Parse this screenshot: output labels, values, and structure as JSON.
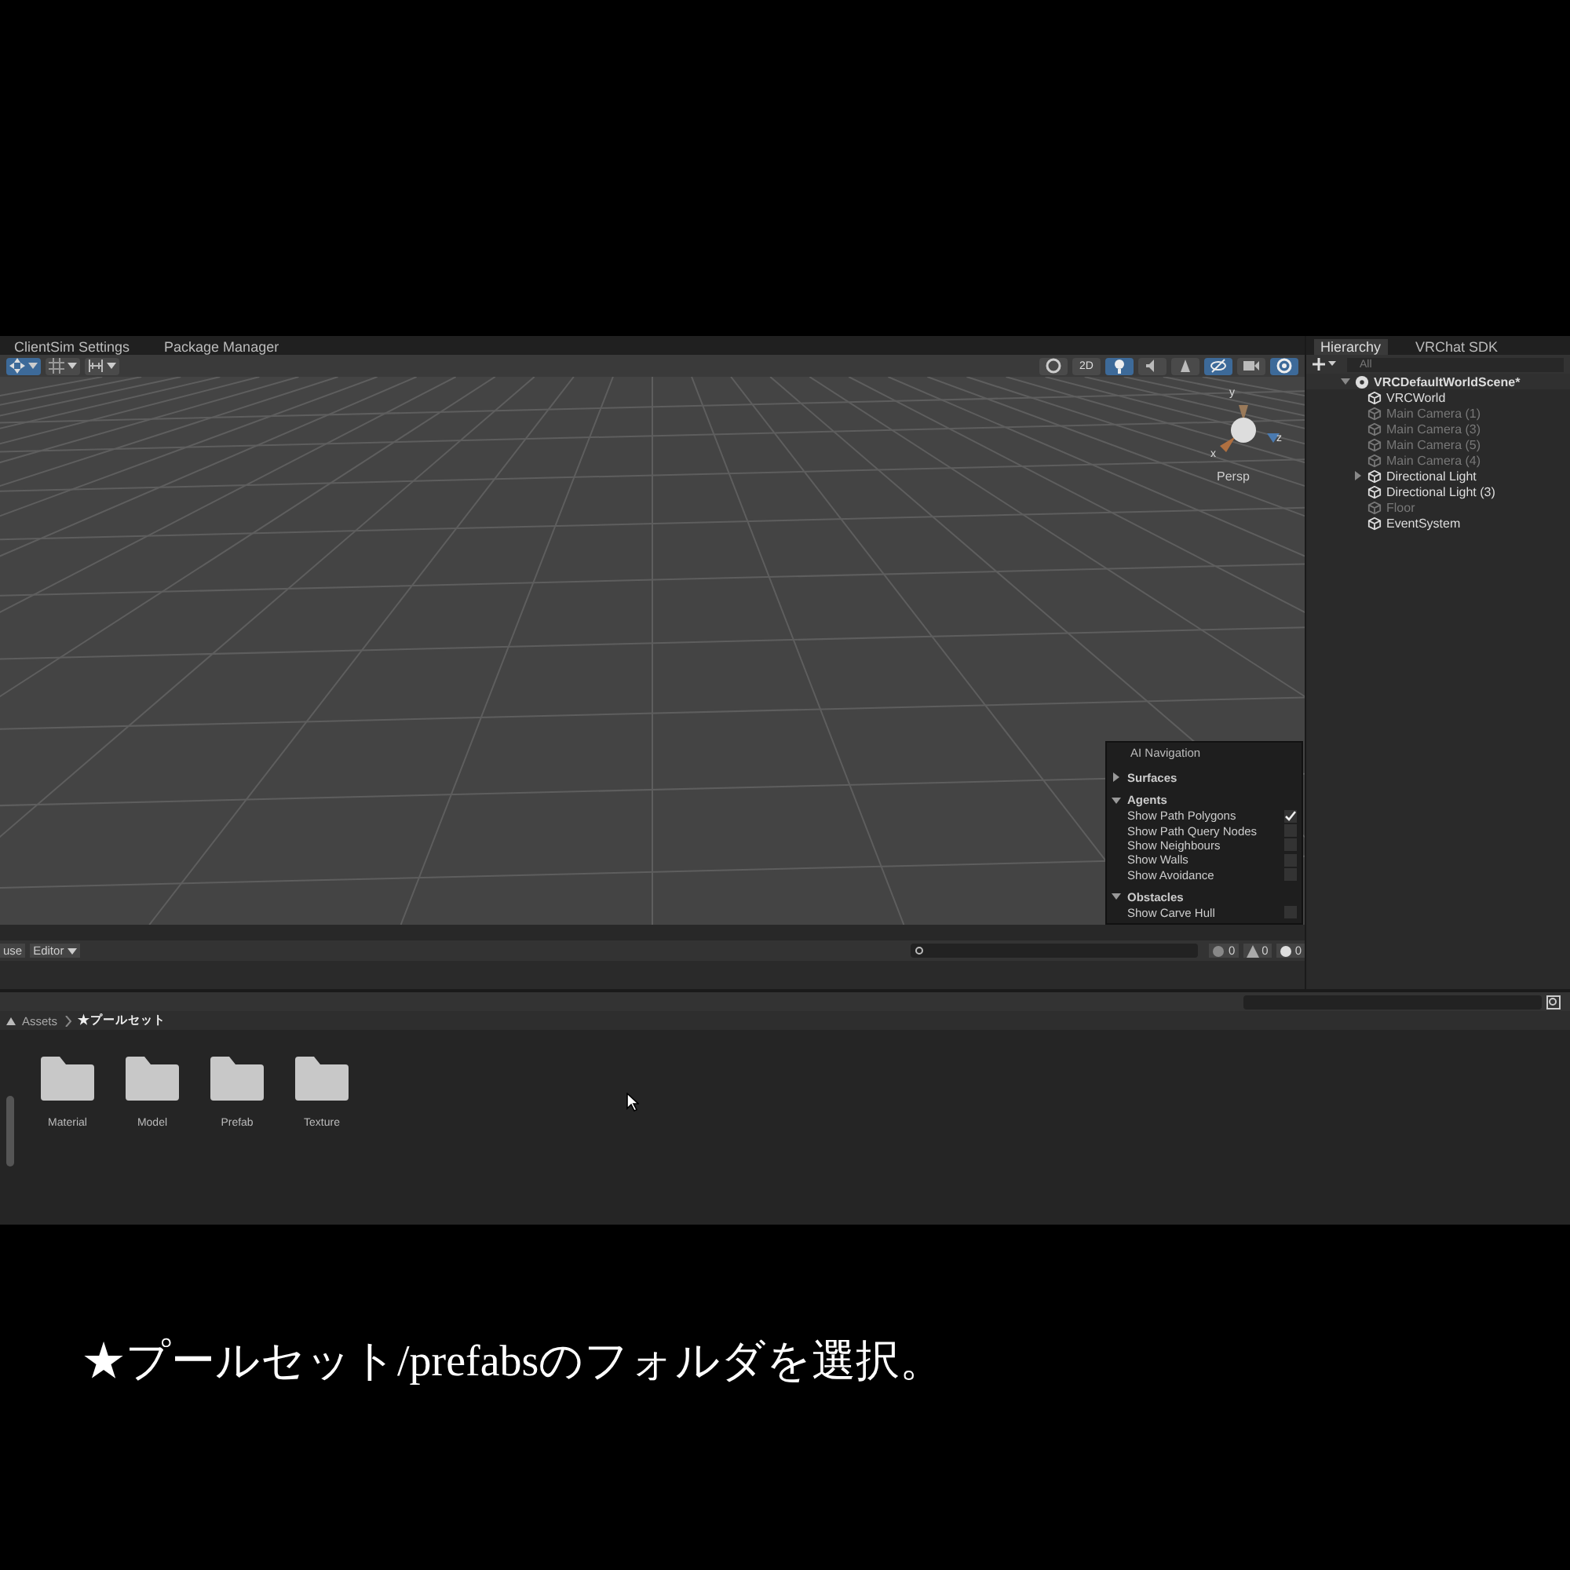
{
  "tabs_left": [
    {
      "label": "ClientSim Settings",
      "selected": false
    },
    {
      "label": "Package Manager",
      "selected": false
    }
  ],
  "scene_toolbar_left": [
    {
      "kind": "move",
      "selected": true
    },
    {
      "kind": "grid",
      "selected": false
    },
    {
      "kind": "snap",
      "selected": false
    }
  ],
  "scene_toolbar_right": [
    {
      "kind": "shading",
      "selected": false
    },
    {
      "kind": "text",
      "label": "2D",
      "selected": false
    },
    {
      "kind": "light",
      "selected": true
    },
    {
      "kind": "audio",
      "selected": false
    },
    {
      "kind": "effects",
      "selected": false
    },
    {
      "kind": "hidden",
      "selected": true
    },
    {
      "kind": "camera",
      "selected": false
    },
    {
      "kind": "gizmos",
      "selected": true
    }
  ],
  "gizmo": {
    "axis_y": "y",
    "axis_x": "x",
    "axis_z": "z",
    "projection": "Persp"
  },
  "ai_navigation": {
    "title": "AI Navigation",
    "sections": [
      {
        "label": "Surfaces",
        "expanded": false
      },
      {
        "label": "Agents",
        "expanded": true,
        "options": [
          {
            "label": "Show Path Polygons",
            "checked": true
          },
          {
            "label": "Show Path Query Nodes",
            "checked": false
          },
          {
            "label": "Show Neighbours",
            "checked": false
          },
          {
            "label": "Show Walls",
            "checked": false
          },
          {
            "label": "Show Avoidance",
            "checked": false
          }
        ]
      },
      {
        "label": "Obstacles",
        "expanded": true,
        "options": [
          {
            "label": "Show Carve Hull",
            "checked": false
          }
        ]
      }
    ]
  },
  "hierarchy": {
    "tabs": [
      {
        "label": "Hierarchy",
        "selected": true
      },
      {
        "label": "VRChat SDK",
        "selected": false
      }
    ],
    "search_placeholder": "All",
    "scene": {
      "name": "VRCDefaultWorldScene*",
      "expanded": true,
      "children": [
        {
          "name": "VRCWorld",
          "active": true,
          "has_children": false
        },
        {
          "name": "Main Camera (1)",
          "active": false,
          "has_children": false
        },
        {
          "name": "Main Camera (3)",
          "active": false,
          "has_children": false
        },
        {
          "name": "Main Camera (5)",
          "active": false,
          "has_children": false
        },
        {
          "name": "Main Camera (4)",
          "active": false,
          "has_children": false
        },
        {
          "name": "Directional Light",
          "active": true,
          "has_children": true
        },
        {
          "name": "Directional Light (3)",
          "active": true,
          "has_children": false
        },
        {
          "name": "Floor",
          "active": false,
          "has_children": false
        },
        {
          "name": "EventSystem",
          "active": true,
          "has_children": false
        }
      ]
    }
  },
  "console": {
    "pause_label": "use",
    "editor_label": "Editor",
    "info_count": "0",
    "warning_count": "0",
    "error_count": "0"
  },
  "project": {
    "breadcrumb": [
      "Assets",
      "★プールセット"
    ],
    "folders": [
      "Material",
      "Model",
      "Prefab",
      "Texture"
    ]
  },
  "caption": "★プールセット/prefabsのフォルダを選択。"
}
